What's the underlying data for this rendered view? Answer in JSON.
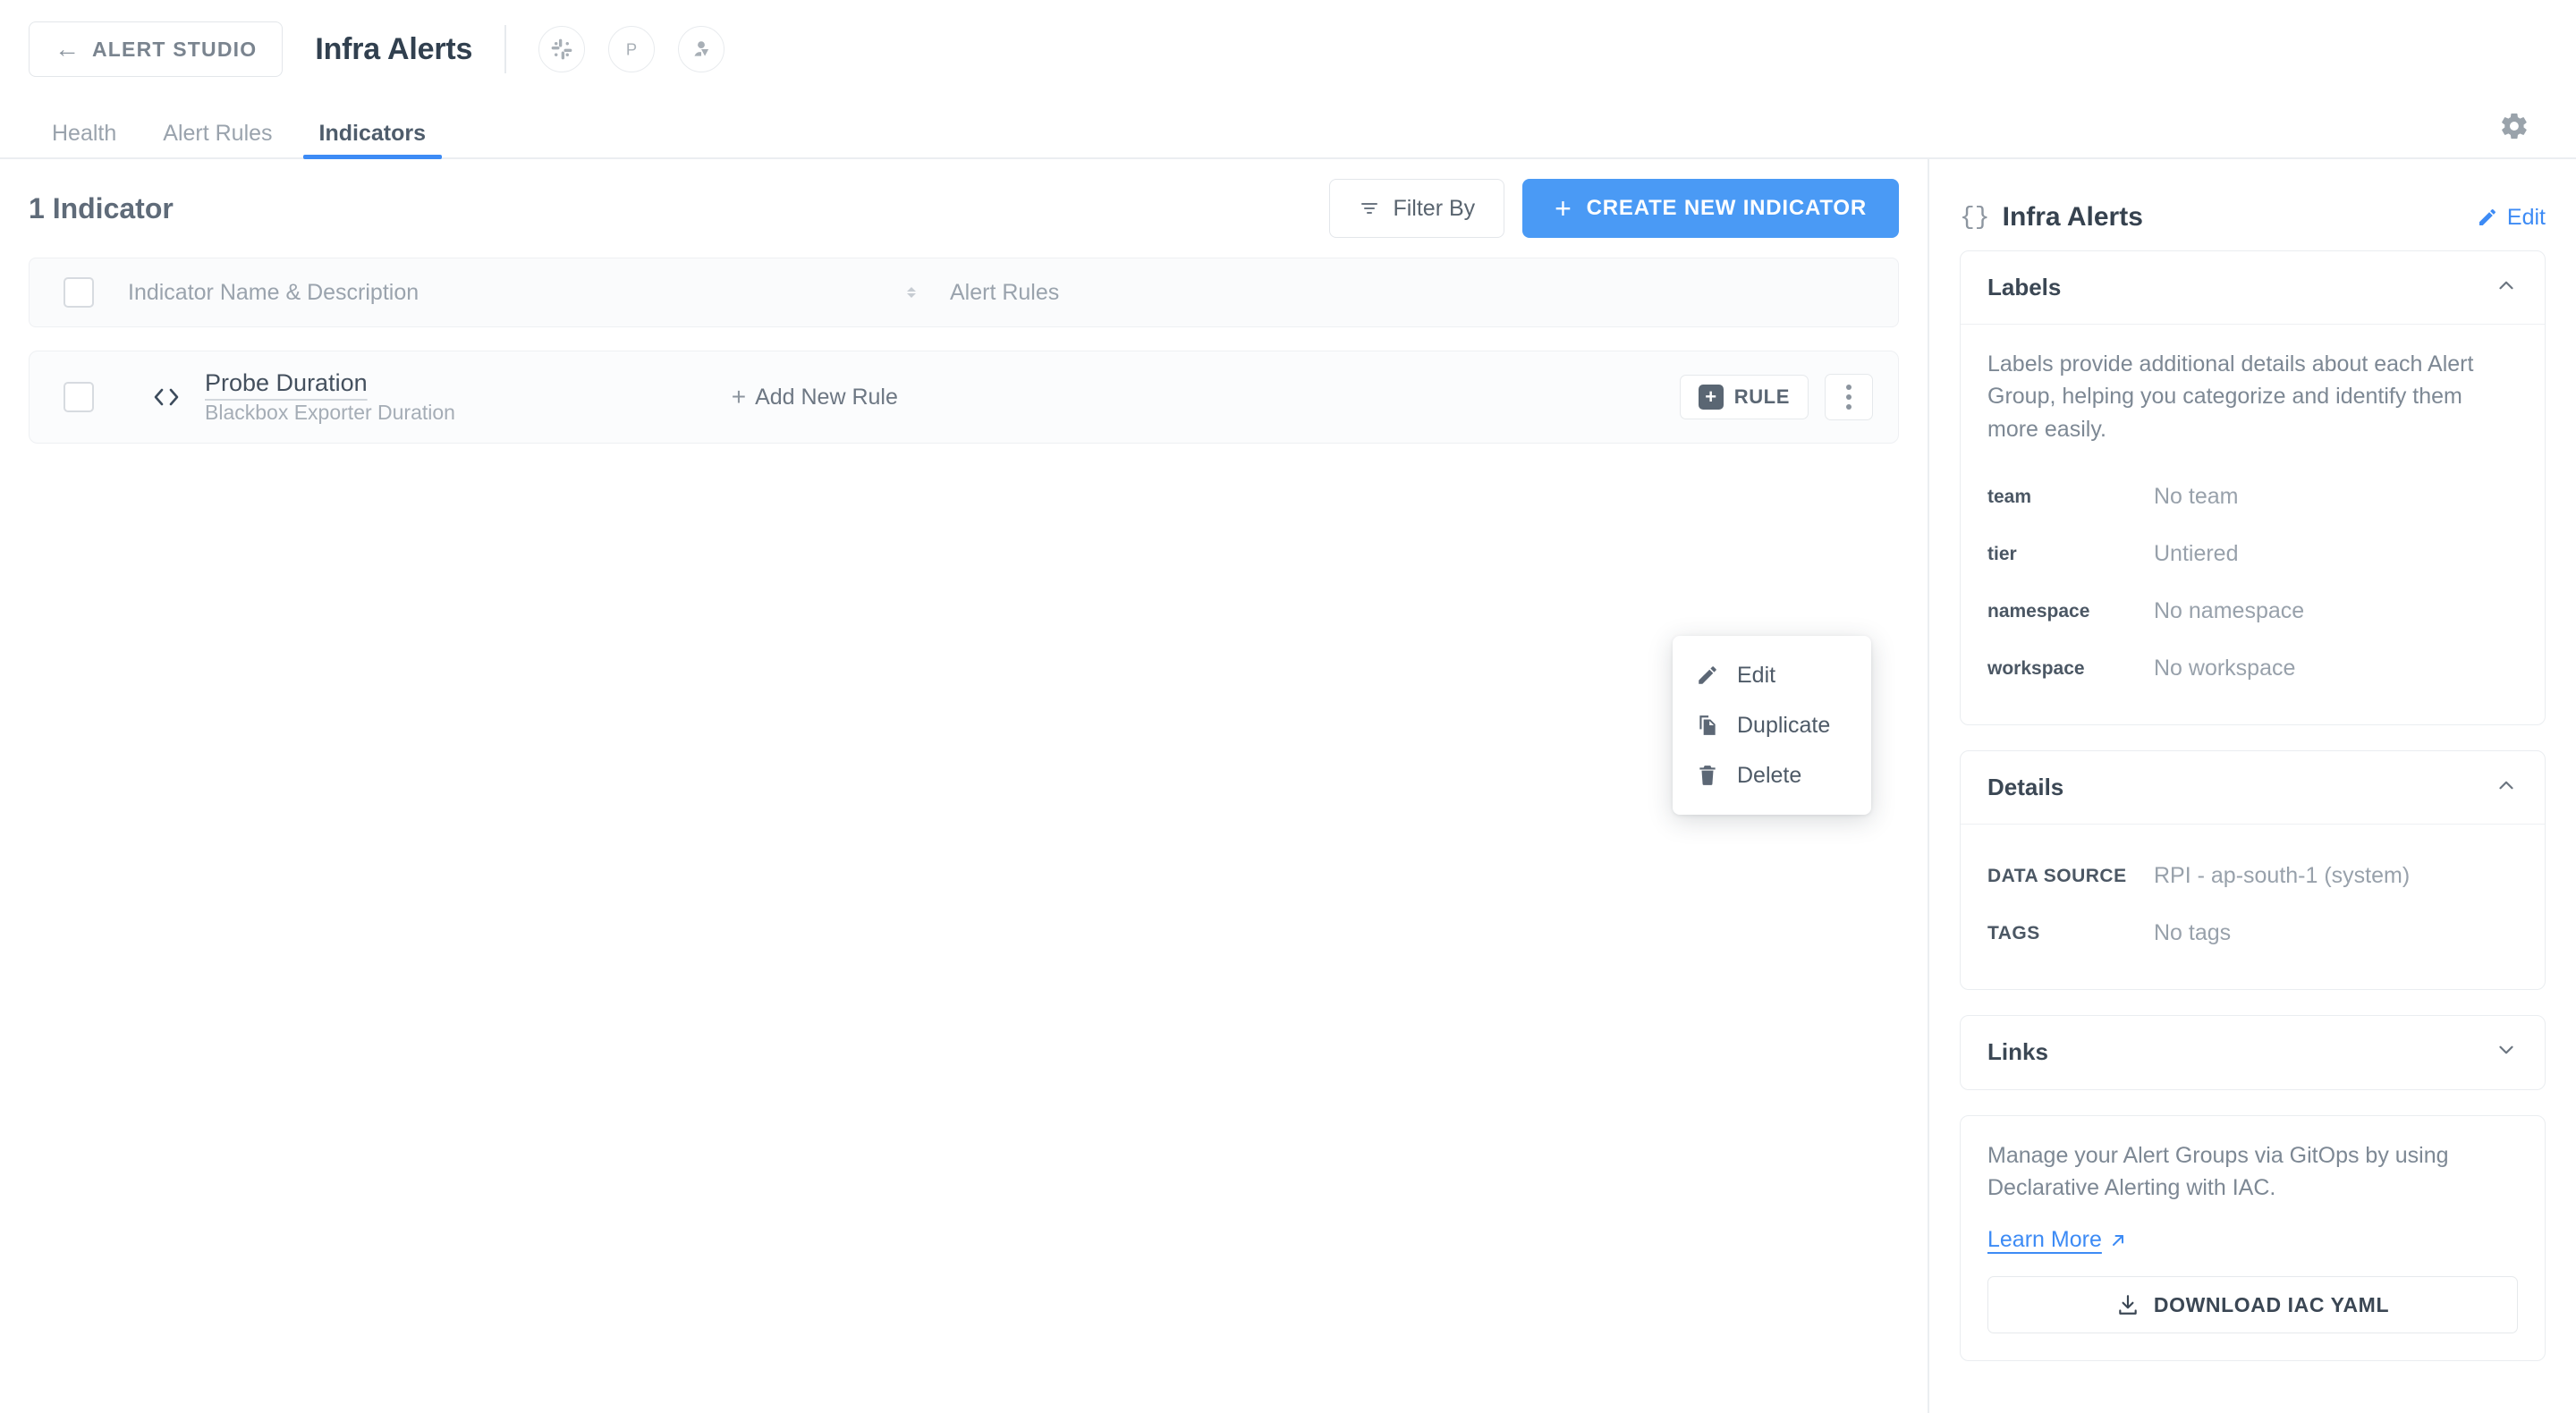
{
  "topbar": {
    "back_label": "ALERT STUDIO",
    "back_icon": "arrow-left-icon",
    "title": "Infra Alerts",
    "integrations": [
      {
        "name": "slack-icon",
        "label": "Slack"
      },
      {
        "name": "pagerduty-icon",
        "label": "P"
      },
      {
        "name": "user-download-icon",
        "label": "Assign"
      }
    ]
  },
  "tabs": {
    "items": [
      {
        "label": "Health",
        "active": false
      },
      {
        "label": "Alert Rules",
        "active": false
      },
      {
        "label": "Indicators",
        "active": true
      }
    ],
    "settings_icon": "gear-icon"
  },
  "main": {
    "count_title": "1 Indicator",
    "filter_label": "Filter By",
    "filter_icon": "filter-icon",
    "create_label": "CREATE NEW INDICATOR",
    "create_icon": "plus-icon",
    "table": {
      "columns": [
        "Indicator Name & Description",
        "Alert Rules"
      ],
      "rows": [
        {
          "name": "Probe Duration",
          "description": "Blackbox Exporter Duration",
          "code_icon": "code-brackets-icon",
          "add_rule_label": "Add New Rule",
          "rule_badge_label": "RULE",
          "kebab_icon": "more-vertical-icon"
        }
      ]
    },
    "context_menu": {
      "items": [
        {
          "label": "Edit",
          "icon": "pencil-icon"
        },
        {
          "label": "Duplicate",
          "icon": "copy-icon"
        },
        {
          "label": "Delete",
          "icon": "trash-icon"
        }
      ]
    }
  },
  "sidebar": {
    "title": "Infra Alerts",
    "braces_icon": "curly-braces-icon",
    "edit_label": "Edit",
    "edit_icon": "pencil-icon",
    "labels_panel": {
      "title": "Labels",
      "collapse_icon": "chevron-up-icon",
      "description": "Labels provide additional details about each Alert Group, helping you categorize and identify them more easily.",
      "rows": [
        {
          "key": "team",
          "value": "No team"
        },
        {
          "key": "tier",
          "value": "Untiered"
        },
        {
          "key": "namespace",
          "value": "No namespace"
        },
        {
          "key": "workspace",
          "value": "No workspace"
        }
      ]
    },
    "details_panel": {
      "title": "Details",
      "collapse_icon": "chevron-up-icon",
      "rows": [
        {
          "key": "DATA SOURCE",
          "value": "RPI - ap-south-1 (system)"
        },
        {
          "key": "TAGS",
          "value": "No tags"
        }
      ]
    },
    "links_panel": {
      "title": "Links",
      "collapse_icon": "chevron-down-icon"
    },
    "gitops_panel": {
      "description": "Manage your Alert Groups via GitOps by using Declarative Alerting with IAC.",
      "learn_more_label": "Learn More",
      "learn_more_icon": "external-link-icon",
      "download_label": "DOWNLOAD IAC YAML",
      "download_icon": "download-icon"
    }
  },
  "colors": {
    "accent_blue": "#4a9af5",
    "link_blue": "#3d8bf5",
    "text_dark": "#36424f",
    "text_muted": "#98a1ab",
    "border": "#eaedf0"
  }
}
